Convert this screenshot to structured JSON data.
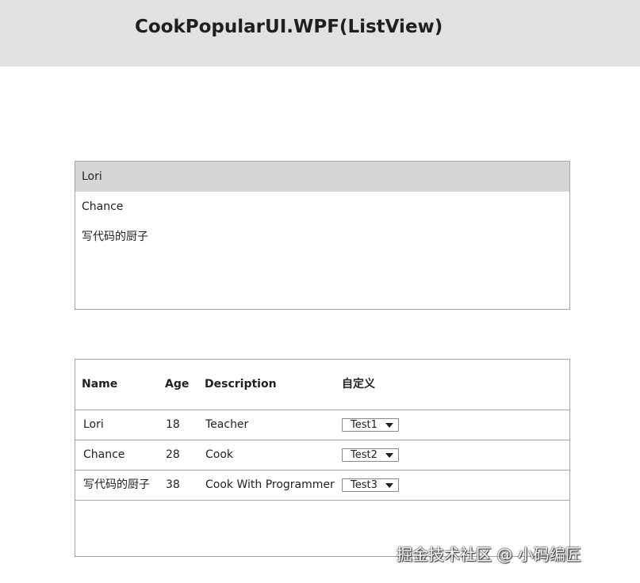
{
  "window": {
    "title": "CookPopularUI.WPF(ListView)"
  },
  "simple_list": {
    "items": [
      {
        "label": "Lori",
        "selected": true
      },
      {
        "label": "Chance",
        "selected": false
      },
      {
        "label": "写代码的厨子",
        "selected": false
      }
    ]
  },
  "grid": {
    "columns": [
      "Name",
      "Age",
      "Description",
      "自定义"
    ],
    "rows": [
      {
        "name": "Lori",
        "age": "18",
        "description": "Teacher",
        "custom": "Test1"
      },
      {
        "name": "Chance",
        "age": "28",
        "description": "Cook",
        "custom": "Test2"
      },
      {
        "name": "写代码的厨子",
        "age": "38",
        "description": "Cook With Programmer",
        "custom": "Test3"
      }
    ]
  },
  "watermark": {
    "text": "掘金技术社区 @ 小码编匠"
  },
  "colors": {
    "titlebar_background": "#e1e1e1",
    "selected_item_background": "#d6d6d6",
    "border": "#a6a6a6"
  }
}
